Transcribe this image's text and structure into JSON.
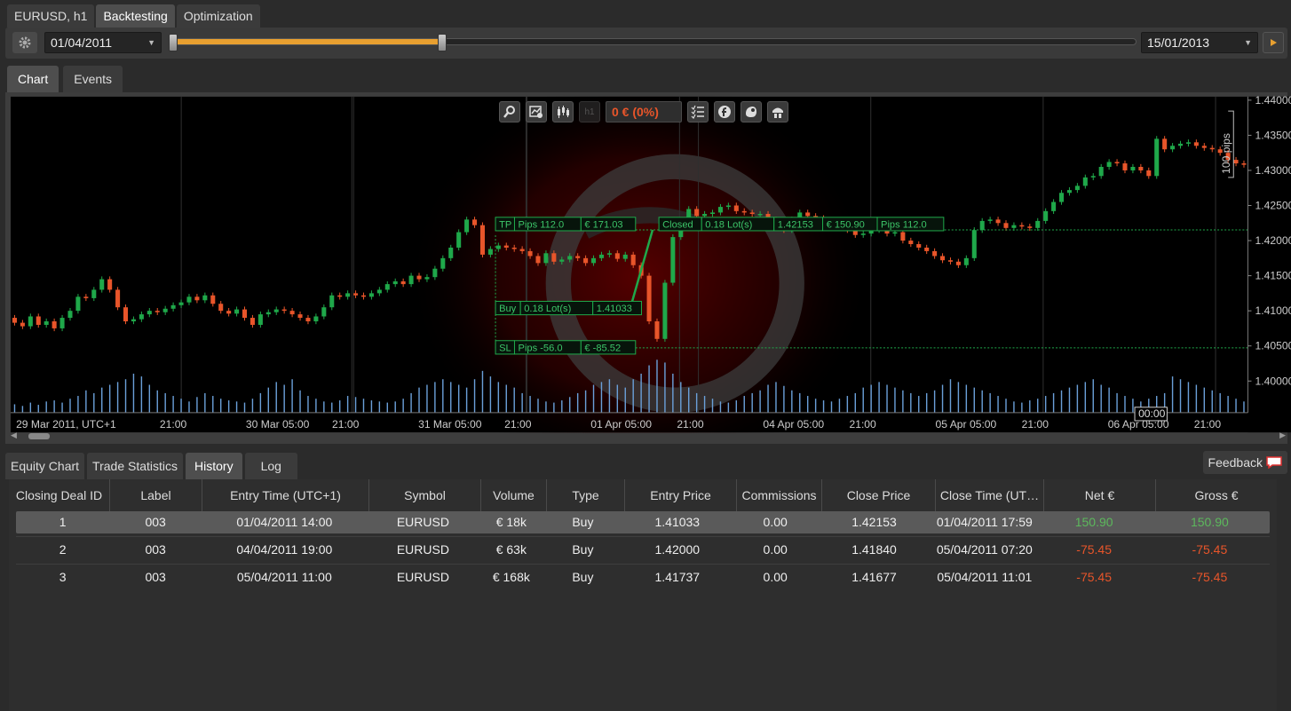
{
  "top_tabs": [
    "EURUSD, h1",
    "Backtesting",
    "Optimization"
  ],
  "period": {
    "start_date": "01/04/2011",
    "end_date": "15/01/2013",
    "progress_fraction": 0.28
  },
  "chart_tabs": [
    "Chart",
    "Events"
  ],
  "chart_toolbar": {
    "icons": [
      "zoom-icon",
      "chart-settings-icon",
      "candles-icon",
      "timeframe-icon",
      "checklist-icon",
      "f-icon",
      "drop-icon",
      "trader-icon"
    ],
    "timeframe_label": "h1",
    "pnl": "0 € (0%)"
  },
  "chart_data": {
    "type": "candlestick",
    "symbol": "EURUSD",
    "timeframe": "h1",
    "ylim": [
      1.3955,
      1.4405
    ],
    "price_ticks": [
      "1.44000",
      "1.43500",
      "1.43000",
      "1.42500",
      "1.42000",
      "1.41500",
      "1.41000",
      "1.40500",
      "1.40000"
    ],
    "time_ticks": [
      "29 Mar 2011, UTC+1",
      "21:00",
      "30 Mar 05:00",
      "21:00",
      "31 Mar 05:00",
      "21:00",
      "01 Apr 05:00",
      "21:00",
      "04 Apr 05:00",
      "21:00",
      "05 Apr 05:00",
      "21:00",
      "06 Apr 05:00",
      "21:00"
    ],
    "crosshair_time": "00:00",
    "range_label": "100 pips",
    "colors": {
      "bull": "#1fa84a",
      "bear": "#e8552a",
      "volume": "#6a9fd8",
      "background": "#000000"
    },
    "closes": [
      1.4083,
      1.4078,
      1.4092,
      1.408,
      1.4085,
      1.4075,
      1.409,
      1.41,
      1.412,
      1.4118,
      1.413,
      1.4145,
      1.413,
      1.4105,
      1.4085,
      1.4088,
      1.4095,
      1.41,
      1.4098,
      1.4103,
      1.4108,
      1.4112,
      1.412,
      1.4115,
      1.4122,
      1.411,
      1.41,
      1.4096,
      1.4102,
      1.409,
      1.408,
      1.4095,
      1.4098,
      1.4102,
      1.41,
      1.4095,
      1.409,
      1.4085,
      1.4092,
      1.4105,
      1.4122,
      1.412,
      1.4125,
      1.4122,
      1.412,
      1.4125,
      1.413,
      1.4138,
      1.4142,
      1.4138,
      1.415,
      1.4145,
      1.4148,
      1.416,
      1.4175,
      1.419,
      1.4212,
      1.423,
      1.4222,
      1.418,
      1.4188,
      1.4193,
      1.419,
      1.4188,
      1.4185,
      1.4178,
      1.4168,
      1.4182,
      1.417,
      1.4173,
      1.4178,
      1.4175,
      1.4168,
      1.4175,
      1.418,
      1.4182,
      1.4174,
      1.418,
      1.4165,
      1.415,
      1.4085,
      1.406,
      1.414,
      1.4205,
      1.4228,
      1.4245,
      1.4235,
      1.4238,
      1.424,
      1.4248,
      1.425,
      1.4242,
      1.424,
      1.4238,
      1.4238,
      1.423,
      1.4222,
      1.4215,
      1.423,
      1.424,
      1.4235,
      1.4232,
      1.4228,
      1.4225,
      1.422,
      1.4215,
      1.4208,
      1.421,
      1.4215,
      1.4218,
      1.421,
      1.4212,
      1.42,
      1.4195,
      1.419,
      1.4185,
      1.4178,
      1.4172,
      1.417,
      1.4165,
      1.4175,
      1.4215,
      1.4228,
      1.423,
      1.4225,
      1.4218,
      1.4222,
      1.422,
      1.4218,
      1.4228,
      1.4242,
      1.4255,
      1.4268,
      1.4272,
      1.4278,
      1.429,
      1.4292,
      1.4305,
      1.4312,
      1.431,
      1.43,
      1.4305,
      1.43,
      1.4292,
      1.4345,
      1.433,
      1.4335,
      1.4338,
      1.434,
      1.4335,
      1.4332,
      1.433,
      1.4325,
      1.4315,
      1.431,
      1.4308
    ],
    "opens": [
      1.409,
      1.4083,
      1.4078,
      1.4092,
      1.408,
      1.4085,
      1.4075,
      1.409,
      1.41,
      1.412,
      1.4118,
      1.413,
      1.4145,
      1.413,
      1.4105,
      1.4085,
      1.4088,
      1.4095,
      1.41,
      1.4098,
      1.4103,
      1.4108,
      1.4112,
      1.412,
      1.4115,
      1.4122,
      1.411,
      1.41,
      1.4096,
      1.4102,
      1.409,
      1.408,
      1.4095,
      1.4098,
      1.4102,
      1.41,
      1.4095,
      1.409,
      1.4085,
      1.4092,
      1.4105,
      1.4122,
      1.412,
      1.4125,
      1.4122,
      1.412,
      1.4125,
      1.413,
      1.4138,
      1.4142,
      1.4138,
      1.415,
      1.4145,
      1.4148,
      1.416,
      1.4175,
      1.419,
      1.4212,
      1.423,
      1.4222,
      1.418,
      1.4188,
      1.4193,
      1.419,
      1.4188,
      1.4185,
      1.4178,
      1.4168,
      1.4182,
      1.417,
      1.4173,
      1.4178,
      1.4175,
      1.4168,
      1.4175,
      1.418,
      1.4182,
      1.4174,
      1.418,
      1.4165,
      1.415,
      1.4085,
      1.406,
      1.414,
      1.4205,
      1.4228,
      1.4245,
      1.4235,
      1.4238,
      1.424,
      1.4248,
      1.425,
      1.4242,
      1.424,
      1.4238,
      1.4238,
      1.423,
      1.4222,
      1.4215,
      1.423,
      1.424,
      1.4235,
      1.4232,
      1.4228,
      1.4225,
      1.422,
      1.4215,
      1.4208,
      1.421,
      1.4215,
      1.4218,
      1.421,
      1.4212,
      1.42,
      1.4195,
      1.419,
      1.4185,
      1.4178,
      1.4172,
      1.417,
      1.4165,
      1.4175,
      1.4215,
      1.4228,
      1.423,
      1.4225,
      1.4218,
      1.4222,
      1.422,
      1.4218,
      1.4228,
      1.4242,
      1.4255,
      1.4268,
      1.4272,
      1.4278,
      1.429,
      1.4292,
      1.4305,
      1.4312,
      1.431,
      1.43,
      1.4305,
      1.43,
      1.4292,
      1.4345,
      1.433,
      1.4335,
      1.4338,
      1.434,
      1.4335,
      1.4332,
      1.433,
      1.4325,
      1.4315,
      1.431
    ],
    "volumes": [
      0.15,
      0.12,
      0.18,
      0.14,
      0.2,
      0.22,
      0.18,
      0.25,
      0.3,
      0.4,
      0.35,
      0.45,
      0.5,
      0.55,
      0.6,
      0.7,
      0.65,
      0.5,
      0.4,
      0.35,
      0.3,
      0.25,
      0.2,
      0.28,
      0.35,
      0.3,
      0.25,
      0.22,
      0.2,
      0.18,
      0.25,
      0.35,
      0.45,
      0.55,
      0.5,
      0.6,
      0.4,
      0.3,
      0.25,
      0.2,
      0.18,
      0.22,
      0.3,
      0.28,
      0.25,
      0.22,
      0.2,
      0.18,
      0.2,
      0.25,
      0.35,
      0.45,
      0.5,
      0.55,
      0.6,
      0.55,
      0.5,
      0.45,
      0.6,
      0.75,
      0.65,
      0.55,
      0.5,
      0.45,
      0.35,
      0.3,
      0.25,
      0.2,
      0.18,
      0.22,
      0.28,
      0.35,
      0.4,
      0.5,
      0.55,
      0.6,
      0.5,
      0.45,
      0.6,
      0.7,
      0.85,
      0.95,
      0.9,
      0.7,
      0.55,
      0.45,
      0.35,
      0.3,
      0.25,
      0.2,
      0.18,
      0.22,
      0.3,
      0.35,
      0.4,
      0.5,
      0.55,
      0.48,
      0.4,
      0.35,
      0.3,
      0.25,
      0.22,
      0.2,
      0.25,
      0.3,
      0.35,
      0.45,
      0.5,
      0.55,
      0.5,
      0.45,
      0.4,
      0.35,
      0.3,
      0.35,
      0.4,
      0.5,
      0.6,
      0.55,
      0.5,
      0.45,
      0.4,
      0.35,
      0.3,
      0.25,
      0.2,
      0.18,
      0.22,
      0.25,
      0.3,
      0.35,
      0.4,
      0.45,
      0.5,
      0.55,
      0.6,
      0.5,
      0.45,
      0.35,
      0.3,
      0.25,
      0.2,
      0.25,
      0.3,
      0.35,
      0.65,
      0.6,
      0.55,
      0.5,
      0.45,
      0.4,
      0.35,
      0.3,
      0.25,
      0.2,
      0.18,
      0.15
    ],
    "trade": {
      "tp_label": "TP",
      "tp_pips": "Pips 112.0",
      "tp_money": "€ 171.03",
      "buy_label": "Buy",
      "buy_lots": "0.18 Lot(s)",
      "buy_price": "1.41033",
      "sl_label": "SL",
      "sl_pips": "Pips -56.0",
      "sl_money": "€ -85.52",
      "closed_label": "Closed",
      "closed_lots": "0.18 Lot(s)",
      "closed_price": "1.42153",
      "closed_money": "€ 150.90",
      "closed_pips": "Pips 112.0",
      "tp_price": 1.42153,
      "entry_price": 1.41033,
      "sl_price": 1.40473
    }
  },
  "bottom_tabs": [
    "Equity Chart",
    "Trade Statistics",
    "History",
    "Log"
  ],
  "feedback_label": "Feedback",
  "history_table": {
    "columns": [
      "Closing Deal ID",
      "Label",
      "Entry Time (UTC+1)",
      "Symbol",
      "Volume",
      "Type",
      "Entry Price",
      "Commissions",
      "Close Price",
      "Close Time (UT…",
      "Net €",
      "Gross €"
    ],
    "rows": [
      [
        "1",
        "003",
        "01/04/2011 14:00",
        "EURUSD",
        "€ 18k",
        "Buy",
        "1.41033",
        "0.00",
        "1.42153",
        "01/04/2011 17:59",
        "150.90",
        "150.90"
      ],
      [
        "2",
        "003",
        "04/04/2011 19:00",
        "EURUSD",
        "€ 63k",
        "Buy",
        "1.42000",
        "0.00",
        "1.41840",
        "05/04/2011 07:20",
        "-75.45",
        "-75.45"
      ],
      [
        "3",
        "003",
        "05/04/2011 11:00",
        "EURUSD",
        "€ 168k",
        "Buy",
        "1.41737",
        "0.00",
        "1.41677",
        "05/04/2011 11:01",
        "-75.45",
        "-75.45"
      ]
    ]
  }
}
